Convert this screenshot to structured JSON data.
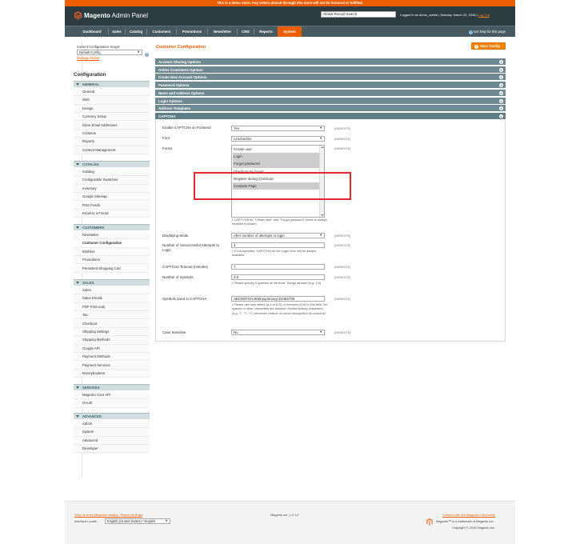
{
  "demo_notice": "This is a demo store. Any orders placed through this store will not be honored or fulfilled.",
  "header": {
    "logo_brand": "Magento",
    "logo_suffix": "Admin Panel",
    "search_placeholder": "Global Record Search",
    "logged_in": "Logged in as demo_admin",
    "date": "Monday, March 23, 2015",
    "logout": "Log Out"
  },
  "nav": {
    "items": [
      "Dashboard",
      "Sales",
      "Catalog",
      "Customers",
      "Promotions",
      "Newsletter",
      "CMS",
      "Reports",
      "System"
    ],
    "active": "System",
    "help": "Get help for this page"
  },
  "sidebar": {
    "scope_label": "Current Configuration Scope:",
    "scope_value": "Default Config",
    "manage_stores": "Manage Stores",
    "title": "Configuration",
    "sections": [
      {
        "title": "GENERAL",
        "items": [
          "General",
          "Web",
          "Design",
          "Currency Setup",
          "Store Email Addresses",
          "Contacts",
          "Reports",
          "Content Management"
        ]
      },
      {
        "title": "CATALOG",
        "items": [
          "Catalog",
          "Configurable Swatches",
          "Inventory",
          "Google Sitemap",
          "RSS Feeds",
          "Email to a Friend"
        ]
      },
      {
        "title": "CUSTOMERS",
        "items": [
          "Newsletter",
          "Customer Configuration",
          "Wishlist",
          "Promotions",
          "Persistent Shopping Cart"
        ]
      },
      {
        "title": "SALES",
        "items": [
          "Sales",
          "Sales Emails",
          "PDF Print-outs",
          "Tax",
          "Checkout",
          "Shipping Settings",
          "Shipping Methods",
          "Google API",
          "Payment Methods",
          "Payment Services",
          "Moneybookers"
        ]
      },
      {
        "title": "SERVICES",
        "items": [
          "Magento Core API",
          "OAuth"
        ]
      },
      {
        "title": "ADVANCED",
        "items": [
          "Admin",
          "System",
          "Advanced",
          "Developer"
        ]
      }
    ],
    "active_item": "Customer Configuration"
  },
  "main": {
    "title": "Customer Configuration",
    "save_label": "Save Config",
    "groups": [
      "Account Sharing Options",
      "Online Customers Options",
      "Create New Account Options",
      "Password Options",
      "Name and Address Options",
      "Login Options",
      "Address Templates",
      "CAPTCHA"
    ],
    "scope_tag": "[WEBSITE]",
    "captcha": {
      "enable_label": "Enable CAPTCHA on Frontend",
      "enable_value": "Yes",
      "font_label": "Font",
      "font_value": "LinLibertine",
      "forms_label": "Forms",
      "forms_options": [
        "Create user",
        "Login",
        "Forgot password",
        "Checkout as Guest",
        "Register during Checkout",
        "Contacts Page"
      ],
      "forms_note": "CAPTCHA for \"Create user\" and \"Forgot password\" forms is always enabled if chosen",
      "mode_label": "Displaying Mode",
      "mode_value": "After number of attempts to login",
      "attempts_label": "Number of Unsuccessful Attempts to Login",
      "attempts_value": "3",
      "attempts_note": "If 0 is specified, CAPTCHA on the Login form will be always available",
      "timeout_label": "CAPTCHA Timeout (minutes)",
      "timeout_value": "7",
      "symbols_label": "Number of Symbols",
      "symbols_value": "4-5",
      "symbols_note": "Please specify 8 symbols at the most. Range allowed (e.g. 3-5)",
      "used_label": "Symbols Used in CAPTCHA",
      "used_value": "ABCDEFGHJKMnpqrstuvxyz23456789",
      "used_note": "Please use only letters (a-z or A-Z) or numbers (0-9) in this field. No spaces or other characters are allowed. Similar looking characters (e.g. \"i\", \"l\", \"1\") decrease chance of correct recognition by customer",
      "case_label": "Case Sensitive",
      "case_value": "No"
    }
  },
  "footer": {
    "help_link": "Help Us Keep Magento Healthy - Report All Bugs",
    "locale_label": "Interface Locale:",
    "locale_value": "English (United States) / English",
    "version": "Magento ver. 1.9.1.0",
    "community_link": "Connect with the Magento Community",
    "trademark": "Magento™ is a trademark of Magento Inc.",
    "copyright": "Copyright © 2015 Magento Inc."
  },
  "colors": {
    "accent": "#eb5e00",
    "header": "#2b3b40",
    "nav": "#465a60",
    "group_bar": "#6f8992",
    "highlight": "#e0262e"
  }
}
